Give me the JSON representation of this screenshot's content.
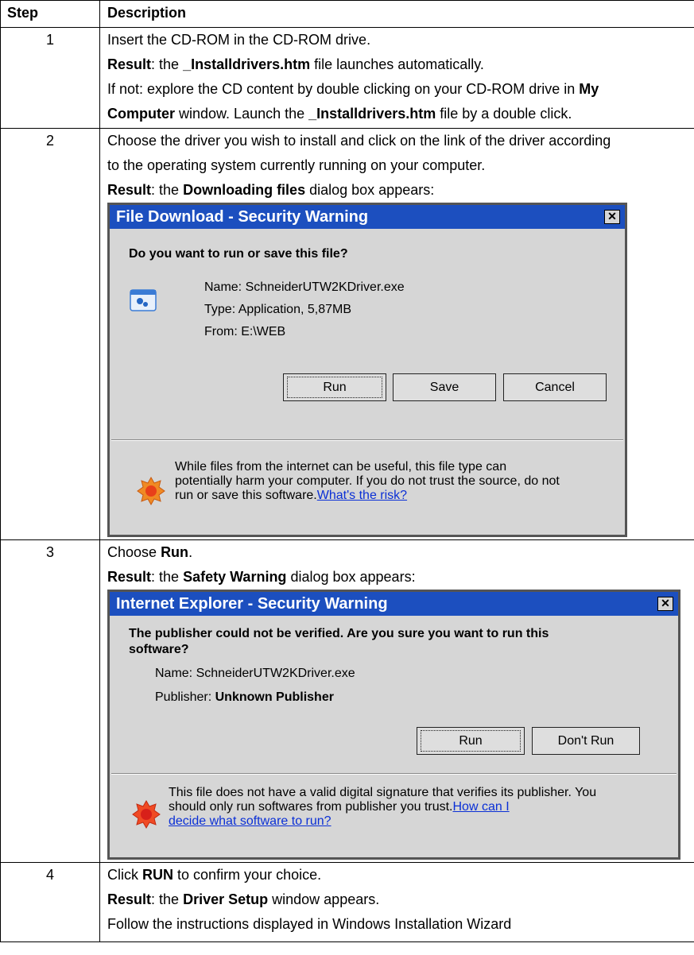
{
  "header": {
    "step": "Step",
    "description": "Description"
  },
  "steps": [
    {
      "num": "1",
      "lines": [
        "Insert the CD-ROM in the CD-ROM drive.",
        "the",
        "_Installdrivers.htm",
        "file launches automatically.",
        "If not: explore the CD content by double clicking on your CD-ROM drive in",
        "My",
        "Computer",
        "window. Launch the",
        "file by a double click."
      ]
    },
    {
      "num": "2",
      "line1": "Choose the driver you wish to install and click on the link of the driver according",
      "line2": "to the operating system currently running on your computer.",
      "result_text_pre": "the",
      "result_bold": "Downloading files",
      "result_text_post": "dialog box appears:"
    },
    {
      "num": "3",
      "choose_pre": "Choose",
      "choose_bold": "Run",
      "result_text_pre": "the",
      "result_bold": "Safety Warning",
      "result_text_post": "dialog box appears:"
    },
    {
      "num": "4",
      "click_pre": "Click",
      "click_bold": "RUN",
      "click_post": "to confirm your choice.",
      "result_text_pre": "the",
      "result_bold": "Driver Setup",
      "result_text_post": "window appears.",
      "line3": "Follow the instructions displayed in Windows Installation Wizard"
    }
  ],
  "result_label": "Result",
  "dialog1": {
    "title": "File Download - Security Warning",
    "close": "✕",
    "question": "Do you want to run or save this file?",
    "name": "Name: SchneiderUTW2KDriver.exe",
    "type": "Type: Application, 5,87MB",
    "from": "From: E:\\WEB",
    "buttons": {
      "run": "Run",
      "save": "Save",
      "cancel": "Cancel"
    },
    "warning_l1": "While files from the internet can be useful, this file type can",
    "warning_l2": "potentially harm your computer. If you do not trust the source, do not",
    "warning_l3": "run or save this software.",
    "warning_link": "What's the risk?"
  },
  "dialog2": {
    "title": "Internet Explorer - Security Warning",
    "close": "✕",
    "question_l1": "The publisher could not be verified. Are you sure you want to run this",
    "question_l2": "software?",
    "name": "Name: SchneiderUTW2KDriver.exe",
    "publisher_label": "Publisher:",
    "publisher_value": "Unknown Publisher",
    "buttons": {
      "run": "Run",
      "dont_run": "Don't Run"
    },
    "warning_l1": "This file does not have a valid digital signature that verifies its publisher. You",
    "warning_l2": "should only run softwares from publisher you trust.",
    "warning_link_l1": "How can I",
    "warning_link_l2": "decide what software to run?"
  },
  "colors": {
    "title_bar": "#1c4fbf",
    "dialog_bg": "#d6d6d6",
    "link": "#0a2fd6"
  }
}
